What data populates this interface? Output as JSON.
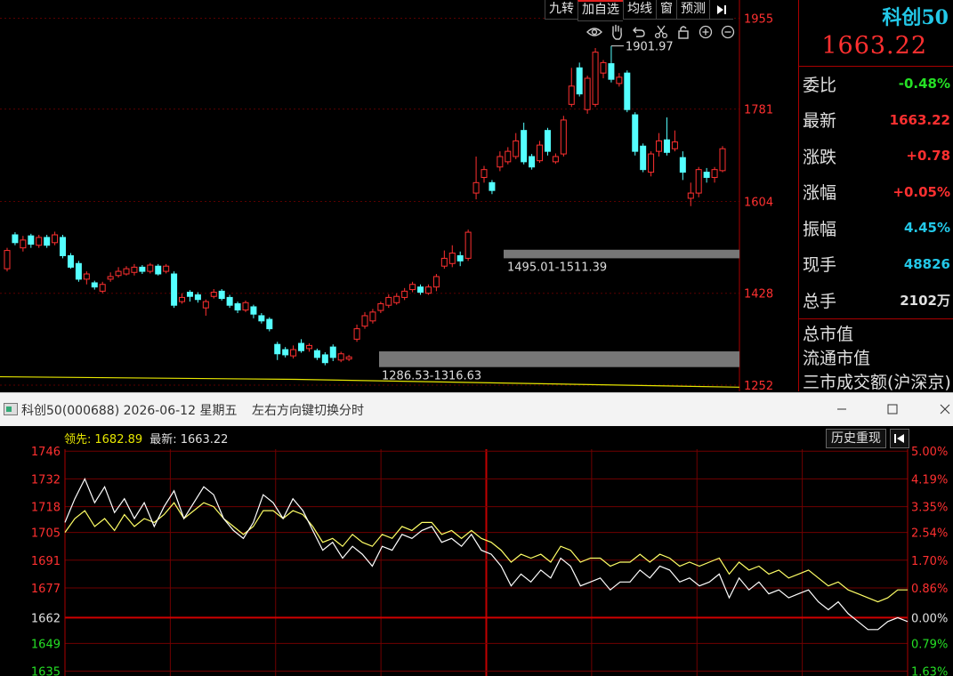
{
  "toolbar": {
    "buttons": [
      "九转",
      "加自选",
      "均线",
      "窗",
      "预测"
    ]
  },
  "panel": {
    "name": "科创50",
    "price": "1663.22",
    "rows": [
      {
        "label": "委比",
        "value": "-0.48%",
        "color": "#25e025"
      },
      {
        "label": "最新",
        "value": "1663.22",
        "color": "#ff3030"
      },
      {
        "label": "涨跌",
        "value": "+0.78",
        "color": "#ff3030"
      },
      {
        "label": "涨幅",
        "value": "+0.05%",
        "color": "#ff3030"
      },
      {
        "label": "振幅",
        "value": "4.45%",
        "color": "#23c8e8"
      },
      {
        "label": "现手",
        "value": "48826",
        "color": "#23c8e8"
      },
      {
        "label": "总手",
        "value": "2102万",
        "color": "#e0e0e0"
      }
    ],
    "market_rows": [
      "总市值",
      "流通市值",
      "三市成交额(沪深京)"
    ]
  },
  "infobar": {
    "title": "科创50(000688) 2026-06-12 星期五",
    "hint": "左右方向键切换分时"
  },
  "intraday_header": {
    "leader_label": "领先:",
    "leader_value": "1682.89",
    "latest_label": "最新:",
    "latest_value": "1663.22",
    "history_button": "历史重现"
  },
  "chart_data": [
    {
      "type": "candlestick",
      "y_ticks": [
        1955,
        1781,
        1604,
        1428,
        1252
      ],
      "ylim": [
        1240,
        1990
      ],
      "annotations": {
        "high_label": "1901.97",
        "zone_upper_label": "1495.01-1511.39",
        "zone_lower_label": "1286.53-1316.63"
      },
      "zones": [
        [
          1495.01,
          1511.39
        ],
        [
          1286.53,
          1316.63
        ]
      ],
      "ma_line": [
        [
          0,
          1268
        ],
        [
          0.4,
          1263
        ],
        [
          1,
          1248
        ]
      ],
      "up_color": "#ff3030",
      "down_color": "#54ffff",
      "candles": [
        {
          "o": 1475,
          "c": 1510,
          "h": 1515,
          "l": 1470
        },
        {
          "o": 1540,
          "c": 1525,
          "h": 1545,
          "l": 1520
        },
        {
          "o": 1515,
          "c": 1530,
          "h": 1538,
          "l": 1508
        },
        {
          "o": 1538,
          "c": 1522,
          "h": 1542,
          "l": 1515
        },
        {
          "o": 1520,
          "c": 1535,
          "h": 1540,
          "l": 1515
        },
        {
          "o": 1535,
          "c": 1520,
          "h": 1540,
          "l": 1515
        },
        {
          "o": 1525,
          "c": 1540,
          "h": 1546,
          "l": 1520
        },
        {
          "o": 1535,
          "c": 1500,
          "h": 1540,
          "l": 1495
        },
        {
          "o": 1500,
          "c": 1478,
          "h": 1505,
          "l": 1475
        },
        {
          "o": 1485,
          "c": 1455,
          "h": 1490,
          "l": 1450
        },
        {
          "o": 1455,
          "c": 1465,
          "h": 1470,
          "l": 1445
        },
        {
          "o": 1448,
          "c": 1440,
          "h": 1452,
          "l": 1435
        },
        {
          "o": 1432,
          "c": 1445,
          "h": 1450,
          "l": 1428
        },
        {
          "o": 1455,
          "c": 1460,
          "h": 1468,
          "l": 1450
        },
        {
          "o": 1462,
          "c": 1470,
          "h": 1478,
          "l": 1458
        },
        {
          "o": 1465,
          "c": 1475,
          "h": 1480,
          "l": 1462
        },
        {
          "o": 1468,
          "c": 1478,
          "h": 1484,
          "l": 1462
        },
        {
          "o": 1478,
          "c": 1470,
          "h": 1482,
          "l": 1465
        },
        {
          "o": 1470,
          "c": 1482,
          "h": 1486,
          "l": 1466
        },
        {
          "o": 1480,
          "c": 1465,
          "h": 1484,
          "l": 1462
        },
        {
          "o": 1470,
          "c": 1480,
          "h": 1484,
          "l": 1466
        },
        {
          "o": 1465,
          "c": 1405,
          "h": 1470,
          "l": 1400
        },
        {
          "o": 1412,
          "c": 1420,
          "h": 1428,
          "l": 1408
        },
        {
          "o": 1430,
          "c": 1422,
          "h": 1434,
          "l": 1412
        },
        {
          "o": 1425,
          "c": 1416,
          "h": 1430,
          "l": 1410
        },
        {
          "o": 1400,
          "c": 1412,
          "h": 1416,
          "l": 1385
        },
        {
          "o": 1422,
          "c": 1430,
          "h": 1436,
          "l": 1418
        },
        {
          "o": 1432,
          "c": 1418,
          "h": 1436,
          "l": 1414
        },
        {
          "o": 1420,
          "c": 1405,
          "h": 1425,
          "l": 1400
        },
        {
          "o": 1408,
          "c": 1396,
          "h": 1412,
          "l": 1390
        },
        {
          "o": 1396,
          "c": 1410,
          "h": 1414,
          "l": 1392
        },
        {
          "o": 1402,
          "c": 1388,
          "h": 1406,
          "l": 1380
        },
        {
          "o": 1385,
          "c": 1375,
          "h": 1390,
          "l": 1370
        },
        {
          "o": 1378,
          "c": 1360,
          "h": 1382,
          "l": 1355
        },
        {
          "o": 1330,
          "c": 1312,
          "h": 1335,
          "l": 1300
        },
        {
          "o": 1320,
          "c": 1310,
          "h": 1325,
          "l": 1305
        },
        {
          "o": 1308,
          "c": 1320,
          "h": 1328,
          "l": 1303
        },
        {
          "o": 1332,
          "c": 1318,
          "h": 1340,
          "l": 1314
        },
        {
          "o": 1322,
          "c": 1328,
          "h": 1332,
          "l": 1316
        },
        {
          "o": 1318,
          "c": 1305,
          "h": 1322,
          "l": 1300
        },
        {
          "o": 1310,
          "c": 1295,
          "h": 1315,
          "l": 1290
        },
        {
          "o": 1325,
          "c": 1305,
          "h": 1330,
          "l": 1298
        },
        {
          "o": 1300,
          "c": 1312,
          "h": 1316,
          "l": 1296
        },
        {
          "o": 1302,
          "c": 1306,
          "h": 1310,
          "l": 1298
        },
        {
          "o": 1340,
          "c": 1360,
          "h": 1368,
          "l": 1335
        },
        {
          "o": 1365,
          "c": 1385,
          "h": 1392,
          "l": 1360
        },
        {
          "o": 1375,
          "c": 1392,
          "h": 1398,
          "l": 1370
        },
        {
          "o": 1395,
          "c": 1408,
          "h": 1412,
          "l": 1390
        },
        {
          "o": 1405,
          "c": 1420,
          "h": 1426,
          "l": 1400
        },
        {
          "o": 1410,
          "c": 1422,
          "h": 1428,
          "l": 1406
        },
        {
          "o": 1420,
          "c": 1432,
          "h": 1438,
          "l": 1415
        },
        {
          "o": 1435,
          "c": 1445,
          "h": 1450,
          "l": 1430
        },
        {
          "o": 1440,
          "c": 1430,
          "h": 1445,
          "l": 1425
        },
        {
          "o": 1428,
          "c": 1440,
          "h": 1445,
          "l": 1425
        },
        {
          "o": 1440,
          "c": 1460,
          "h": 1465,
          "l": 1432
        },
        {
          "o": 1480,
          "c": 1495,
          "h": 1510,
          "l": 1475
        },
        {
          "o": 1485,
          "c": 1505,
          "h": 1520,
          "l": 1478
        },
        {
          "o": 1500,
          "c": 1490,
          "h": 1508,
          "l": 1480
        },
        {
          "o": 1495,
          "c": 1545,
          "h": 1550,
          "l": 1490
        },
        {
          "o": 1620,
          "c": 1640,
          "h": 1690,
          "l": 1608
        },
        {
          "o": 1650,
          "c": 1665,
          "h": 1672,
          "l": 1640
        },
        {
          "o": 1640,
          "c": 1625,
          "h": 1645,
          "l": 1618
        },
        {
          "o": 1670,
          "c": 1690,
          "h": 1700,
          "l": 1662
        },
        {
          "o": 1680,
          "c": 1700,
          "h": 1708,
          "l": 1675
        },
        {
          "o": 1690,
          "c": 1720,
          "h": 1735,
          "l": 1685
        },
        {
          "o": 1740,
          "c": 1680,
          "h": 1755,
          "l": 1675
        },
        {
          "o": 1690,
          "c": 1670,
          "h": 1695,
          "l": 1665
        },
        {
          "o": 1682,
          "c": 1712,
          "h": 1720,
          "l": 1678
        },
        {
          "o": 1740,
          "c": 1700,
          "h": 1745,
          "l": 1692
        },
        {
          "o": 1680,
          "c": 1690,
          "h": 1696,
          "l": 1676
        },
        {
          "o": 1695,
          "c": 1760,
          "h": 1768,
          "l": 1690
        },
        {
          "o": 1790,
          "c": 1825,
          "h": 1860,
          "l": 1785
        },
        {
          "o": 1860,
          "c": 1810,
          "h": 1870,
          "l": 1805
        },
        {
          "o": 1780,
          "c": 1840,
          "h": 1845,
          "l": 1772
        },
        {
          "o": 1790,
          "c": 1890,
          "h": 1898,
          "l": 1785
        },
        {
          "o": 1850,
          "c": 1870,
          "h": 1875,
          "l": 1840
        },
        {
          "o": 1868,
          "c": 1838,
          "h": 1901.97,
          "l": 1832
        },
        {
          "o": 1830,
          "c": 1842,
          "h": 1850,
          "l": 1824
        },
        {
          "o": 1850,
          "c": 1780,
          "h": 1855,
          "l": 1775
        },
        {
          "o": 1770,
          "c": 1700,
          "h": 1775,
          "l": 1692
        },
        {
          "o": 1710,
          "c": 1665,
          "h": 1715,
          "l": 1660
        },
        {
          "o": 1660,
          "c": 1695,
          "h": 1700,
          "l": 1652
        },
        {
          "o": 1700,
          "c": 1720,
          "h": 1735,
          "l": 1690
        },
        {
          "o": 1722,
          "c": 1698,
          "h": 1765,
          "l": 1692
        },
        {
          "o": 1705,
          "c": 1718,
          "h": 1740,
          "l": 1700
        },
        {
          "o": 1688,
          "c": 1660,
          "h": 1700,
          "l": 1645
        },
        {
          "o": 1610,
          "c": 1620,
          "h": 1640,
          "l": 1595
        },
        {
          "o": 1620,
          "c": 1665,
          "h": 1670,
          "l": 1612
        },
        {
          "o": 1660,
          "c": 1650,
          "h": 1668,
          "l": 1640
        },
        {
          "o": 1650,
          "c": 1665,
          "h": 1670,
          "l": 1640
        },
        {
          "o": 1663,
          "c": 1705,
          "h": 1710,
          "l": 1660
        }
      ]
    },
    {
      "type": "line",
      "y_left_ticks": [
        "1746",
        "1732",
        "1718",
        "1705",
        "1691",
        "1677",
        "1662",
        "1649",
        "1635"
      ],
      "y_right_ticks": [
        "5.00%",
        "4.19%",
        "3.35%",
        "2.54%",
        "1.70%",
        "0.86%",
        "0.00%",
        "0.79%",
        "1.63%"
      ],
      "ylim": [
        1633,
        1747
      ],
      "base": 1662,
      "series": [
        {
          "color": "#ffffff",
          "values": [
            1710,
            1722,
            1732,
            1720,
            1728,
            1715,
            1722,
            1712,
            1720,
            1708,
            1718,
            1726,
            1712,
            1720,
            1728,
            1724,
            1712,
            1706,
            1702,
            1710,
            1724,
            1720,
            1712,
            1722,
            1716,
            1706,
            1696,
            1700,
            1692,
            1698,
            1694,
            1688,
            1698,
            1696,
            1704,
            1702,
            1706,
            1708,
            1700,
            1702,
            1698,
            1704,
            1696,
            1694,
            1688,
            1678,
            1684,
            1680,
            1686,
            1682,
            1692,
            1688,
            1678,
            1680,
            1682,
            1676,
            1680,
            1680,
            1686,
            1682,
            1688,
            1686,
            1680,
            1682,
            1678,
            1680,
            1684,
            1672,
            1682,
            1676,
            1680,
            1674,
            1676,
            1672,
            1674,
            1676,
            1670,
            1666,
            1670,
            1664,
            1660,
            1656,
            1656,
            1660,
            1662,
            1660
          ]
        },
        {
          "color": "#ffff66",
          "values": [
            1705,
            1712,
            1716,
            1708,
            1712,
            1706,
            1714,
            1708,
            1712,
            1710,
            1714,
            1720,
            1712,
            1716,
            1720,
            1718,
            1712,
            1708,
            1704,
            1708,
            1716,
            1716,
            1712,
            1716,
            1714,
            1708,
            1700,
            1702,
            1698,
            1704,
            1700,
            1698,
            1704,
            1702,
            1708,
            1706,
            1710,
            1710,
            1704,
            1706,
            1702,
            1706,
            1702,
            1700,
            1696,
            1690,
            1694,
            1692,
            1694,
            1690,
            1698,
            1696,
            1690,
            1692,
            1692,
            1688,
            1690,
            1690,
            1694,
            1690,
            1694,
            1692,
            1688,
            1690,
            1688,
            1690,
            1692,
            1684,
            1690,
            1686,
            1688,
            1684,
            1686,
            1682,
            1684,
            1686,
            1682,
            1678,
            1680,
            1676,
            1674,
            1672,
            1670,
            1672,
            1676,
            1676
          ]
        }
      ]
    }
  ]
}
